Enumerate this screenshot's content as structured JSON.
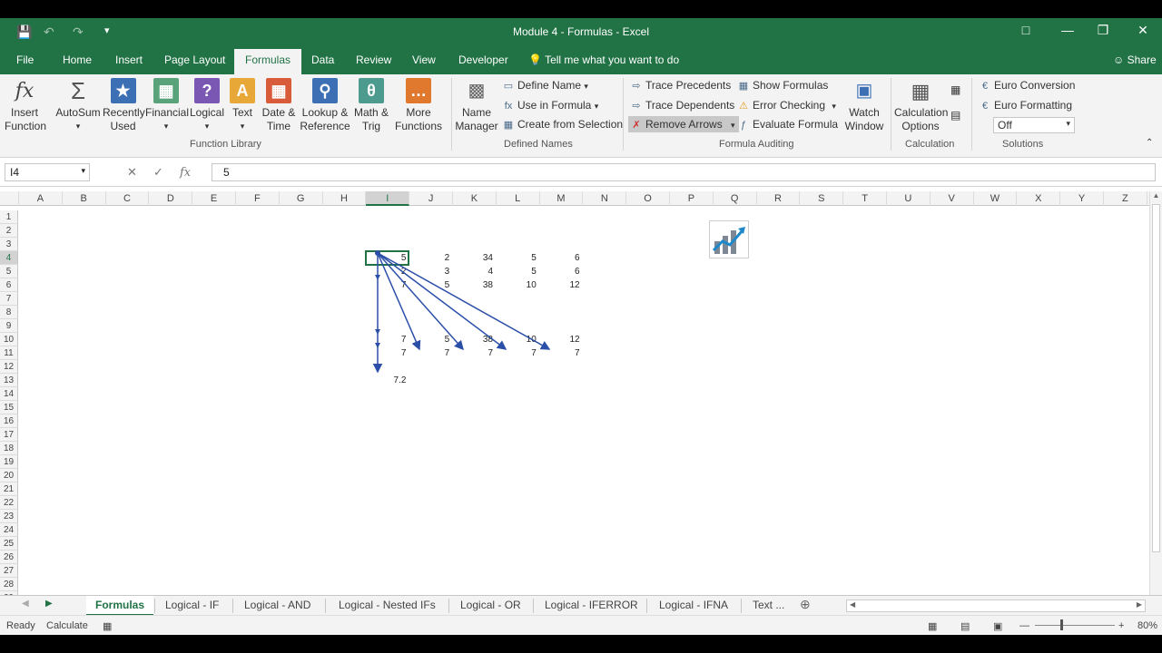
{
  "window": {
    "title": "Module 4 - Formulas  -  Excel",
    "quick_access": [
      "save-icon",
      "undo-icon",
      "redo-icon",
      "customize-icon"
    ],
    "controls": [
      "ribbon-display-icon",
      "minimize-icon",
      "restore-icon",
      "close-icon"
    ]
  },
  "tabs": {
    "items": [
      "File",
      "Home",
      "Insert",
      "Page Layout",
      "Formulas",
      "Data",
      "Review",
      "View",
      "Developer"
    ],
    "active": "Formulas",
    "tell_me": "Tell me what you want to do",
    "share": "Share"
  },
  "ribbon": {
    "function_library": {
      "label": "Function Library",
      "insert_function": "Insert Function",
      "autosum": "AutoSum",
      "recently_used": "Recently Used",
      "financial": "Financial",
      "logical": "Logical",
      "text": "Text",
      "date_time": "Date & Time",
      "lookup": "Lookup & Reference",
      "math": "Math & Trig",
      "more": "More Functions"
    },
    "defined_names": {
      "label": "Defined Names",
      "name_manager": "Name Manager",
      "define_name": "Define Name",
      "use_in_formula": "Use in Formula",
      "create_from_selection": "Create from Selection"
    },
    "formula_auditing": {
      "label": "Formula Auditing",
      "trace_precedents": "Trace Precedents",
      "trace_dependents": "Trace Dependents",
      "remove_arrows": "Remove Arrows",
      "show_formulas": "Show Formulas",
      "error_checking": "Error Checking",
      "evaluate_formula": "Evaluate Formula",
      "watch_window": "Watch Window"
    },
    "calculation": {
      "label": "Calculation",
      "calculation_options": "Calculation Options"
    },
    "solutions": {
      "label": "Solutions",
      "euro_conversion": "Euro Conversion",
      "euro_formatting": "Euro Formatting",
      "dropdown_value": "Off"
    }
  },
  "formula_bar": {
    "name_box": "I4",
    "formula": "5"
  },
  "grid": {
    "columns": [
      "A",
      "B",
      "C",
      "D",
      "E",
      "F",
      "G",
      "H",
      "I",
      "J",
      "K",
      "L",
      "M",
      "N",
      "O",
      "P",
      "Q",
      "R",
      "S",
      "T",
      "U",
      "V",
      "W",
      "X",
      "Y",
      "Z"
    ],
    "selected_column": "I",
    "rows": [
      "1",
      "2",
      "3",
      "4",
      "5",
      "6",
      "7",
      "8",
      "9",
      "10",
      "11",
      "12",
      "13",
      "14",
      "15",
      "16",
      "17",
      "18",
      "19",
      "20",
      "21",
      "22",
      "23",
      "24",
      "25",
      "26",
      "27",
      "28",
      "29"
    ],
    "selected_row": "4",
    "cells": {
      "I4": "5",
      "J4": "2",
      "K4": "34",
      "L4": "5",
      "M4": "6",
      "I5": "2",
      "J5": "3",
      "K5": "4",
      "L5": "5",
      "M5": "6",
      "I6": "7",
      "J6": "5",
      "K6": "38",
      "L6": "10",
      "M6": "12",
      "I10": "7",
      "J10": "5",
      "K10": "38",
      "L10": "10",
      "M10": "12",
      "I11": "7",
      "J11": "7",
      "K11": "7",
      "L11": "7",
      "M11": "7",
      "I13": "7.2"
    }
  },
  "sheets": {
    "items": [
      "Formulas",
      "Logical - IF",
      "Logical - AND",
      "Logical - Nested IFs",
      "Logical - OR",
      "Logical - IFERROR",
      "Logical - IFNA",
      "Text ..."
    ],
    "active": "Formulas"
  },
  "status": {
    "ready": "Ready",
    "calculate": "Calculate",
    "zoom": "80%"
  },
  "colors": {
    "excel_green": "#217346",
    "arrow_blue": "#2b4fa8"
  }
}
